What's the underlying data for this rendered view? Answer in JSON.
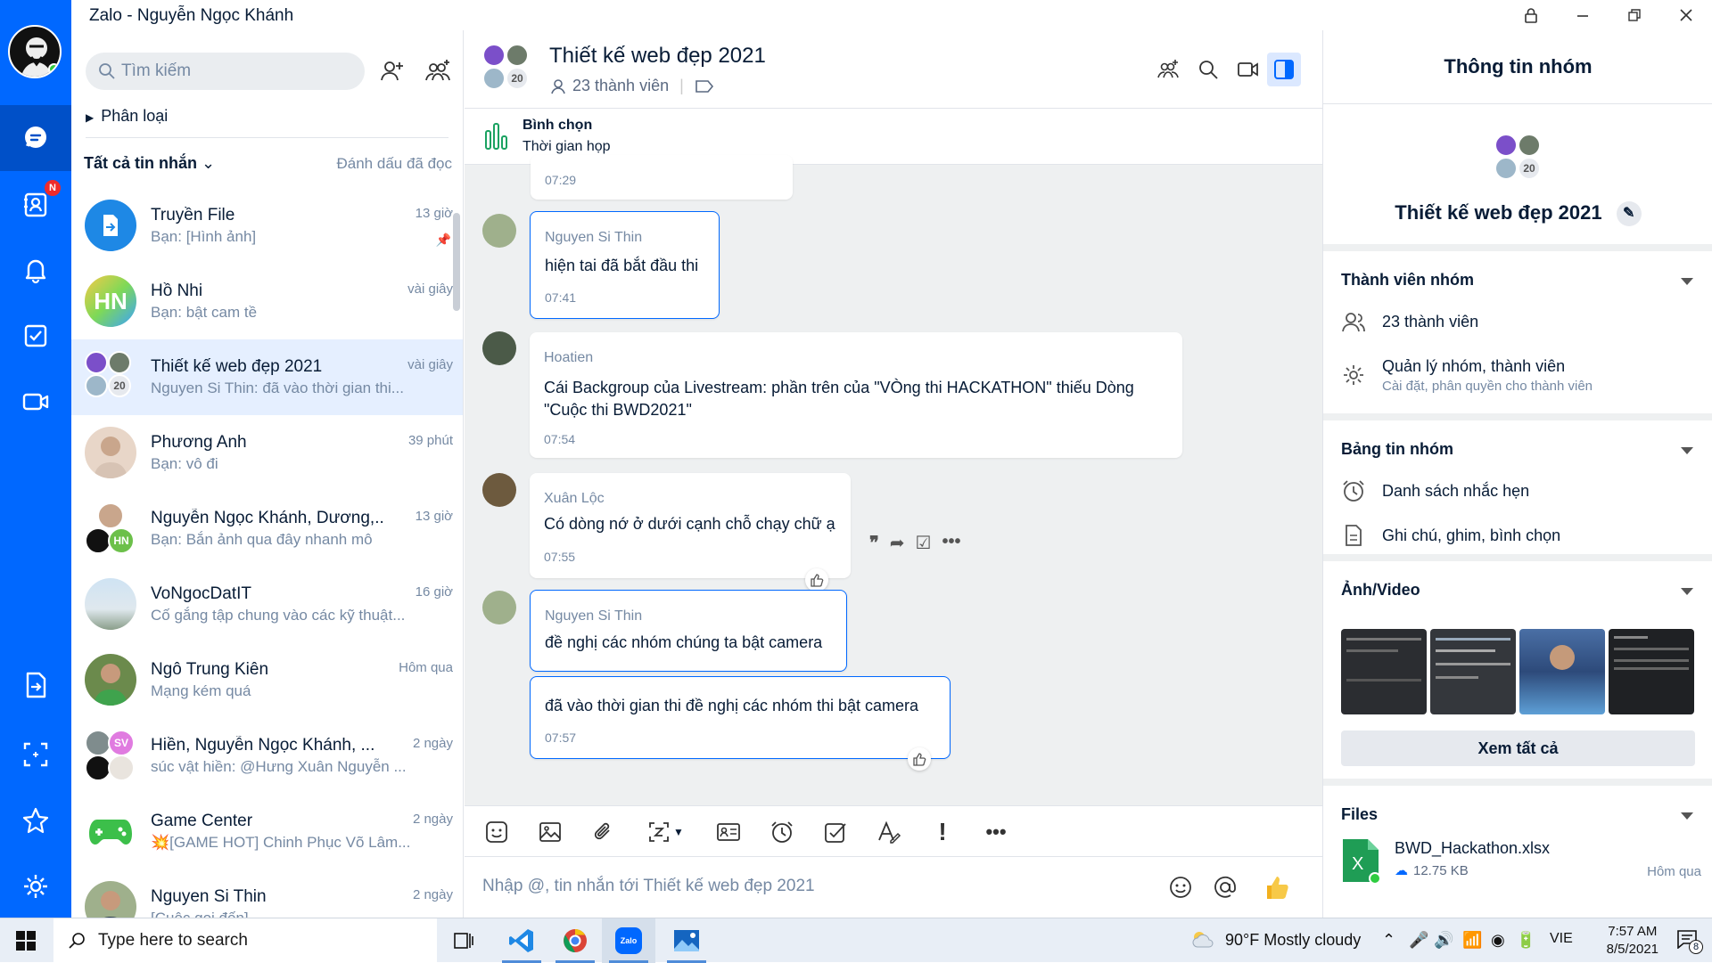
{
  "app": {
    "title": "Zalo - Nguyễn Ngọc Khánh"
  },
  "colors": {
    "brand": "#0068ff",
    "selected": "#e5efff",
    "unread_badge": "#ef2b2b"
  },
  "nav": {
    "items": [
      {
        "name": "messages-icon",
        "active": true
      },
      {
        "name": "contacts-icon",
        "badge": "N"
      },
      {
        "name": "notifications-icon"
      },
      {
        "name": "todo-icon"
      },
      {
        "name": "video-call-icon"
      },
      {
        "name": "file-transfer-icon"
      },
      {
        "name": "screenshot-icon"
      },
      {
        "name": "favorites-icon"
      },
      {
        "name": "settings-icon"
      }
    ]
  },
  "sidebar": {
    "search_placeholder": "Tìm kiếm",
    "classify_label": "Phân loại",
    "filter_label": "Tất cả tin nhắn",
    "mark_read_label": "Đánh dấu đã đọc",
    "conversations": [
      {
        "name": "Truyền File",
        "preview": "Bạn: [Hình ảnh]",
        "time": "13 giờ",
        "pinned": true
      },
      {
        "name": "Hồ Nhi",
        "preview": "Bạn: bật cam tề",
        "time": "vài giây",
        "initials": "HN"
      },
      {
        "name": "Thiết kế web đẹp 2021",
        "preview": "Nguyen Si Thin: đã vào thời gian thi...",
        "time": "vài giây",
        "selected": true,
        "count": "20"
      },
      {
        "name": "Phương Anh",
        "preview": "Bạn: vô đi",
        "time": "39 phút"
      },
      {
        "name": "Nguyễn Ngọc Khánh, Dương,...",
        "preview": "Bạn: Bắn ảnh qua đây nhanh mô",
        "time": "13 giờ",
        "initials": "HN"
      },
      {
        "name": "VoNgocDatIT",
        "preview": "Cố gắng tập chung vào các kỹ thuật...",
        "time": "16 giờ"
      },
      {
        "name": "Ngô Trung Kiên",
        "preview": "Mạng kém quá",
        "time": "Hôm qua"
      },
      {
        "name": "Hiền, Nguyễn Ngọc Khánh, ...",
        "preview": "súc vật hiền: @Hưng Xuân Nguyễn ...",
        "time": "2 ngày",
        "initials": "SV"
      },
      {
        "name": "Game Center",
        "preview": "💥[GAME HOT] Chinh Phục Võ Lâm...",
        "time": "2 ngày"
      },
      {
        "name": "Nguyen Si Thin",
        "preview": "[Cuộc gọi đến]",
        "time": "2 ngày"
      }
    ]
  },
  "chat": {
    "title": "Thiết kế web đẹp 2021",
    "members": "23 thành viên",
    "avatar_count": "20",
    "poll": {
      "title": "Bình chọn",
      "subtitle": "Thời gian họp"
    },
    "messages": [
      {
        "time": "07:29"
      },
      {
        "sender": "Nguyen Si Thin",
        "text": "hiện tai đã bắt đầu thi",
        "time": "07:41"
      },
      {
        "sender": "Hoatien",
        "text": "Cái Backgroup của Livestream: phần trên của \"VÒng thi HACKATHON\" thiếu Dòng \"Cuộc thi BWD2021\"",
        "time": "07:54"
      },
      {
        "sender": "Xuân Lộc",
        "text": "Có dòng nớ ở dưới cạnh chỗ chạy chữ ạ",
        "time": "07:55"
      },
      {
        "sender": "Nguyen Si Thin",
        "text": "đề nghị các nhóm chúng ta bật camera"
      },
      {
        "text": "đã vào thời gian thi đề nghị các nhóm thi bật camera",
        "time": "07:57"
      }
    ],
    "input_placeholder": "Nhập @, tin nhắn tới Thiết kế web đẹp 2021"
  },
  "info": {
    "header": "Thông tin nhóm",
    "group_name": "Thiết kế web đẹp 2021",
    "avatar_count": "20",
    "members_section": "Thành viên nhóm",
    "members_count": "23 thành viên",
    "manage_title": "Quản lý nhóm, thành viên",
    "manage_sub": "Cài đặt, phân quyền cho thành viên",
    "board_section": "Bảng tin nhóm",
    "reminders": "Danh sách nhắc hẹn",
    "notes": "Ghi chú, ghim, bình chọn",
    "media_section": "Ảnh/Video",
    "see_all": "Xem tất cả",
    "files_section": "Files",
    "file_name": "BWD_Hackathon.xlsx",
    "file_size": "12.75 KB",
    "file_time": "Hôm qua"
  },
  "taskbar": {
    "search_placeholder": "Type here to search",
    "weather": "90°F  Mostly cloudy",
    "lang": "VIE",
    "time": "7:57 AM",
    "date": "8/5/2021",
    "notif_count": "8"
  }
}
